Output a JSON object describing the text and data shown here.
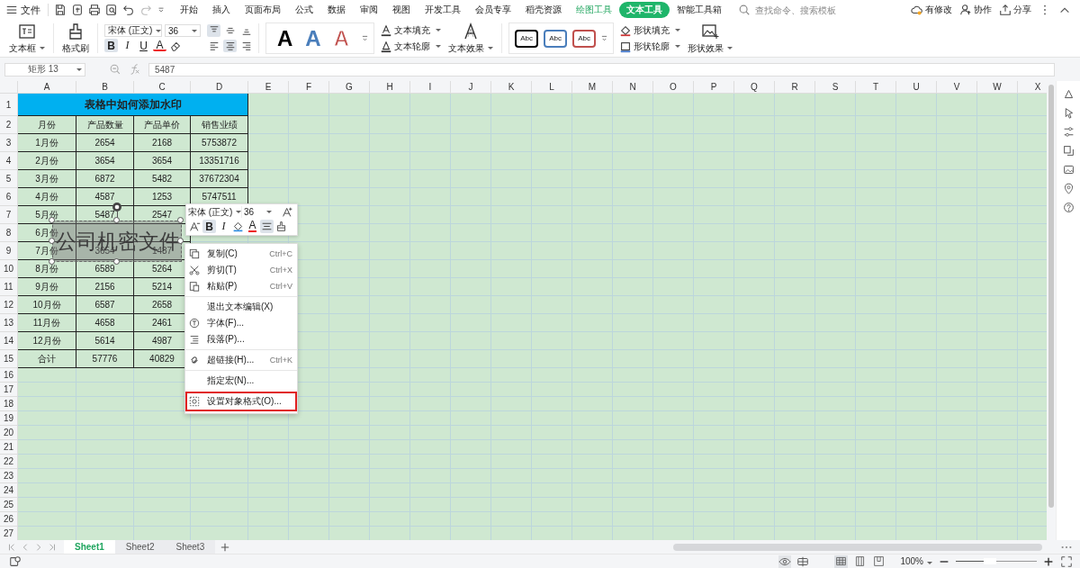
{
  "menu": {
    "file": "文件",
    "tabs": [
      {
        "label": "开始",
        "kind": "normal",
        "selected": false
      },
      {
        "label": "插入",
        "kind": "normal",
        "selected": false
      },
      {
        "label": "页面布局",
        "kind": "normal",
        "selected": false
      },
      {
        "label": "公式",
        "kind": "normal",
        "selected": false
      },
      {
        "label": "数据",
        "kind": "normal",
        "selected": false
      },
      {
        "label": "审阅",
        "kind": "normal",
        "selected": false
      },
      {
        "label": "视图",
        "kind": "normal",
        "selected": false
      },
      {
        "label": "开发工具",
        "kind": "normal",
        "selected": false
      },
      {
        "label": "会员专享",
        "kind": "normal",
        "selected": false
      },
      {
        "label": "稻壳资源",
        "kind": "normal",
        "selected": false
      },
      {
        "label": "绘图工具",
        "kind": "contextual",
        "selected": false
      },
      {
        "label": "文本工具",
        "kind": "contextual",
        "selected": true
      },
      {
        "label": "智能工具箱",
        "kind": "normal",
        "selected": false
      }
    ],
    "search": {
      "placeholder": "查找命令、搜索模板"
    },
    "actions": [
      "有修改",
      "协作",
      "分享"
    ]
  },
  "ribbon": {
    "text_box": "文本框",
    "format_painter": "格式刷",
    "font": {
      "family": "宋体 (正文)",
      "size": "36"
    },
    "format_buttons": [
      {
        "label": "B",
        "kind": "bold",
        "selected": true
      },
      {
        "label": "I",
        "kind": "italic",
        "selected": false
      },
      {
        "label": "U",
        "kind": "underline",
        "selected": false
      },
      {
        "label": "A",
        "kind": "color",
        "selected": false
      }
    ],
    "alignment": [
      {
        "kind": "top",
        "selected": true
      },
      {
        "kind": "middle",
        "selected": false
      },
      {
        "kind": "bottom",
        "selected": false
      },
      {
        "kind": "left",
        "selected": false
      },
      {
        "kind": "center",
        "selected": true
      },
      {
        "kind": "right",
        "selected": false
      }
    ],
    "text_styles": [
      {
        "label": "A",
        "kind": "solid",
        "color": "#000000"
      },
      {
        "label": "A",
        "kind": "solid",
        "color": "#4a7ebb"
      },
      {
        "label": "A",
        "kind": "outline",
        "color": "#c0504d"
      }
    ],
    "text_commands": [
      "文本填充",
      "文本轮廓",
      "文本效果"
    ],
    "shape_styles": [
      {
        "label": "Abc",
        "color": "#000000"
      },
      {
        "label": "Abc",
        "color": "#4a7ebb"
      },
      {
        "label": "Abc",
        "color": "#c0504d"
      }
    ],
    "shape_commands": [
      "形状填充",
      "形状轮廓",
      "形状效果"
    ]
  },
  "formula_bar": {
    "name_box": "矩形 13",
    "value": "5487"
  },
  "sheet": {
    "columns": [
      "A",
      "B",
      "C",
      "D",
      "E",
      "F",
      "G",
      "H",
      "I",
      "J",
      "K",
      "L",
      "M",
      "N",
      "O",
      "P",
      "Q",
      "R",
      "S",
      "T",
      "U",
      "V",
      "W",
      "X"
    ],
    "row_headers": [
      "1",
      "2",
      "3",
      "4",
      "5",
      "6",
      "7",
      "8",
      "9",
      "10",
      "11",
      "12",
      "13",
      "14",
      "15",
      "16",
      "17",
      "18",
      "19",
      "20",
      "21",
      "22",
      "23",
      "24",
      "25",
      "26",
      "27"
    ],
    "title": "表格中如何添加水印",
    "header": [
      "月份",
      "产品数量",
      "产品单价",
      "销售业绩"
    ],
    "data": [
      [
        "1月份",
        "2654",
        "2168",
        "5753872"
      ],
      [
        "2月份",
        "3654",
        "3654",
        "13351716"
      ],
      [
        "3月份",
        "6872",
        "5482",
        "37672304"
      ],
      [
        "4月份",
        "4587",
        "1253",
        "5747511"
      ],
      [
        "5月份",
        "5487",
        "2547"
      ],
      [
        "6月份"
      ],
      [
        "7月份",
        "3654",
        "1487"
      ],
      [
        "8月份",
        "6589",
        "5264"
      ],
      [
        "9月份",
        "2156",
        "5214"
      ],
      [
        "10月份",
        "6587",
        "2658"
      ],
      [
        "11月份",
        "4658",
        "2461"
      ],
      [
        "12月份",
        "5614",
        "4987"
      ],
      [
        "合计",
        "57776",
        "40829"
      ]
    ]
  },
  "text_box": {
    "text": "公司机密文件"
  },
  "mini_toolbar": {
    "font": "宋体 (正文)",
    "size": "36",
    "buttons": [
      {
        "kind": "shrink",
        "selected": false
      },
      {
        "kind": "bold",
        "label": "B",
        "selected": true
      },
      {
        "kind": "italic",
        "label": "I",
        "selected": false
      },
      {
        "kind": "fill",
        "selected": false
      },
      {
        "kind": "color",
        "label": "A",
        "selected": false
      },
      {
        "kind": "align",
        "selected": true
      },
      {
        "kind": "painter",
        "selected": false
      }
    ]
  },
  "context_menu": {
    "groups": [
      [
        {
          "kind": "copy",
          "label": "复制(C)",
          "shortcut": "Ctrl+C",
          "outlined": false
        },
        {
          "kind": "cut",
          "label": "剪切(T)",
          "shortcut": "Ctrl+X",
          "outlined": false
        },
        {
          "kind": "paste",
          "label": "粘贴(P)",
          "shortcut": "Ctrl+V",
          "outlined": false
        }
      ],
      [
        {
          "kind": "plain",
          "label": "退出文本编辑(X)",
          "outlined": false
        },
        {
          "kind": "font",
          "label": "字体(F)...",
          "outlined": false
        },
        {
          "kind": "paragraph",
          "label": "段落(P)...",
          "outlined": false
        }
      ],
      [
        {
          "kind": "link",
          "label": "超链接(H)...",
          "shortcut": "Ctrl+K",
          "outlined": false
        }
      ],
      [
        {
          "kind": "plain",
          "label": "指定宏(N)...",
          "outlined": false
        },
        {
          "kind": "format",
          "label": "设置对象格式(O)...",
          "outlined": true
        }
      ]
    ]
  },
  "sheets": [
    {
      "label": "Sheet1",
      "selected": true
    },
    {
      "label": "Sheet2",
      "selected": false
    },
    {
      "label": "Sheet3",
      "selected": false
    }
  ],
  "status_bar": {
    "view_modes": [
      {
        "kind": "normal",
        "selected": true
      },
      {
        "kind": "page",
        "selected": false
      },
      {
        "kind": "break",
        "selected": false
      }
    ],
    "zoom": "100%",
    "zoom_slider": {
      "level": 0.5
    }
  }
}
